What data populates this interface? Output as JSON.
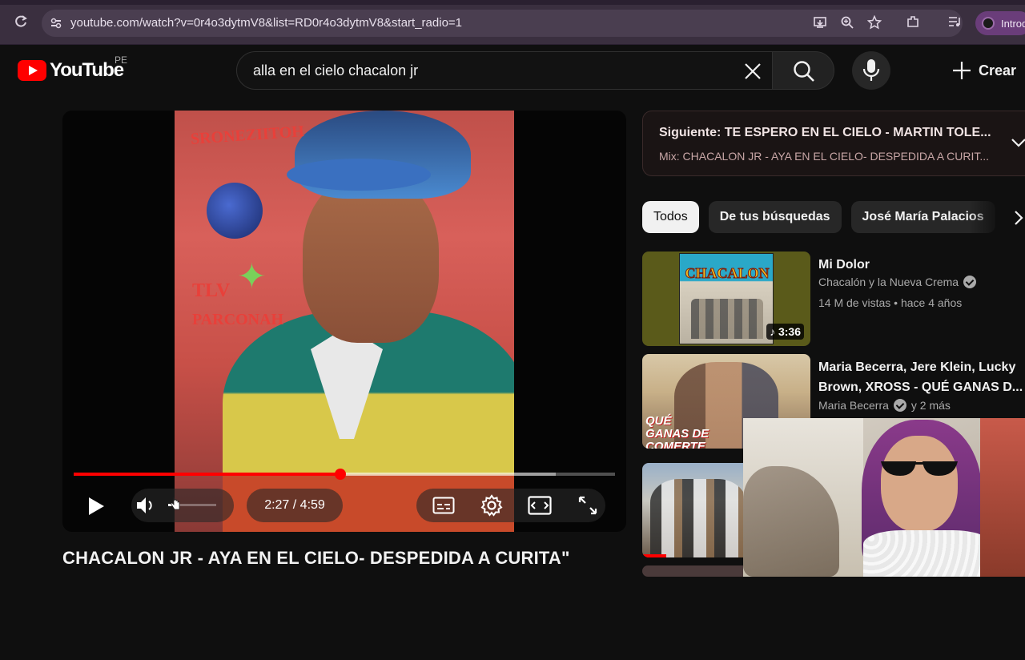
{
  "browser": {
    "url": "youtube.com/watch?v=0r4o3dytmV8&list=RD0r4o3dytmV8&start_radio=1",
    "extension_label": "Introd"
  },
  "header": {
    "logo_text": "YouTube",
    "country": "PE",
    "search_query": "alla en el cielo chacalon jr",
    "create_label": "Crear"
  },
  "player": {
    "time_display": "2:27 / 4:59",
    "progress_fraction": 0.493,
    "loaded_fraction": 0.89,
    "overlay_text_1": "SRONEZIITOH",
    "overlay_text_2": "TLV",
    "overlay_text_3": "PARCONAH"
  },
  "video": {
    "title": "CHACALON JR - AYA EN EL CIELO- DESPEDIDA A CURITA\""
  },
  "up_next": {
    "line1_prefix": "Siguiente: ",
    "line1_title": "TE ESPERO EN EL CIELO - MARTIN TOLE...",
    "line2": "Mix: CHACALON JR - AYA EN EL CIELO- DESPEDIDA A CURIT..."
  },
  "chips": [
    "Todos",
    "De tus búsquedas",
    "José María Palacios"
  ],
  "recommendations": [
    {
      "title": "Mi Dolor",
      "channel": "Chacalón y la Nueva Crema",
      "meta": "14 M de vistas • hace 4 años",
      "duration": "3:36",
      "thumb_text": "CHACALON"
    },
    {
      "title": "Maria Becerra, Jere Klein, Lucky Brown, XROSS - QUÉ GANAS D...",
      "channel": "Maria Becerra",
      "channel_extra": "y 2 más",
      "thumb_text": "QUÉ GANAS DE COMERTE"
    }
  ],
  "colors": {
    "accent": "#ff0000",
    "background": "#0f0f0f",
    "browser_bar": "#3a2f3f"
  }
}
